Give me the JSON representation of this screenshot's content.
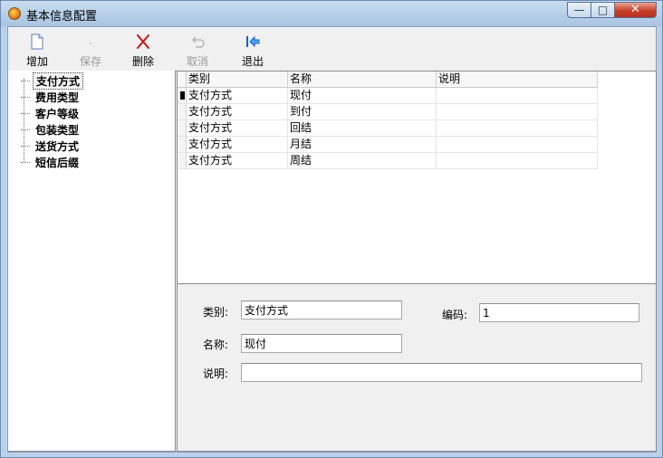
{
  "window": {
    "title": "基本信息配置",
    "controls": {
      "minimize": "—",
      "maximize": "□",
      "close": "✕"
    }
  },
  "toolbar": {
    "add": {
      "label": "增加",
      "icon": "document-icon",
      "enabled": true
    },
    "save": {
      "label": "保存",
      "icon": "save-icon",
      "enabled": false
    },
    "delete": {
      "label": "删除",
      "icon": "red-x-icon",
      "enabled": true,
      "color": "#cc1111"
    },
    "cancel": {
      "label": "取消",
      "icon": "undo-icon",
      "enabled": false
    },
    "exit": {
      "label": "退出",
      "icon": "exit-arrow-icon",
      "enabled": true,
      "color": "#1a5fd0"
    }
  },
  "tree": {
    "selected_index": 0,
    "items": [
      {
        "label": "支付方式"
      },
      {
        "label": "费用类型"
      },
      {
        "label": "客户等级"
      },
      {
        "label": "包装类型"
      },
      {
        "label": "送货方式"
      },
      {
        "label": "短信后缀"
      }
    ]
  },
  "grid": {
    "columns": [
      "类别",
      "名称",
      "说明"
    ],
    "current_row": 0,
    "rows": [
      {
        "category": "支付方式",
        "name": "现付",
        "note": ""
      },
      {
        "category": "支付方式",
        "name": "到付",
        "note": ""
      },
      {
        "category": "支付方式",
        "name": "回结",
        "note": ""
      },
      {
        "category": "支付方式",
        "name": "月结",
        "note": ""
      },
      {
        "category": "支付方式",
        "name": "周结",
        "note": ""
      }
    ]
  },
  "form": {
    "category_label": "类别:",
    "category_value": "支付方式",
    "code_label": "编码:",
    "code_value": "1",
    "name_label": "名称:",
    "name_value": "现付",
    "note_label": "说明:",
    "note_value": ""
  }
}
